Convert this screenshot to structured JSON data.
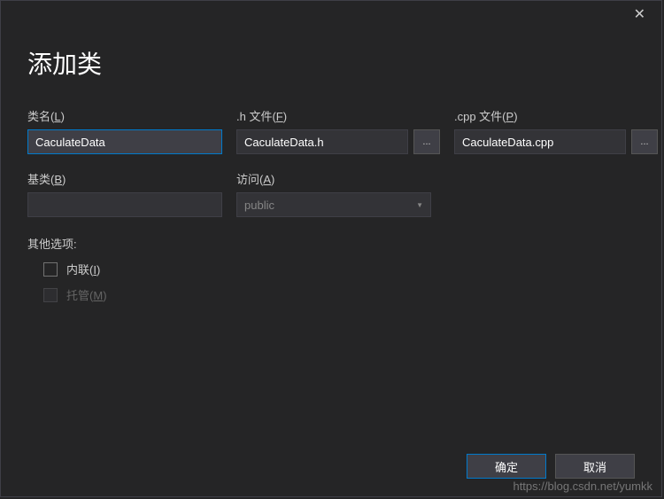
{
  "dialog": {
    "title": "添加类"
  },
  "fields": {
    "class_name": {
      "label": "类名(",
      "accel": "L",
      "label_after": ")",
      "value": "CaculateData"
    },
    "h_file": {
      "label": ".h 文件(",
      "accel": "F",
      "label_after": ")",
      "value": "CaculateData.h",
      "browse": "..."
    },
    "cpp_file": {
      "label": ".cpp 文件(",
      "accel": "P",
      "label_after": ")",
      "value": "CaculateData.cpp",
      "browse": "..."
    },
    "base_class": {
      "label": "基类(",
      "accel": "B",
      "label_after": ")",
      "value": ""
    },
    "access": {
      "label": "访问(",
      "accel": "A",
      "label_after": ")",
      "value": "public"
    }
  },
  "options": {
    "heading": "其他选项:",
    "inline": {
      "label": "内联(",
      "accel": "I",
      "label_after": ")"
    },
    "managed": {
      "label": "托管(",
      "accel": "M",
      "label_after": ")"
    }
  },
  "buttons": {
    "ok": "确定",
    "cancel": "取消"
  },
  "watermark": "https://blog.csdn.net/yumkk"
}
